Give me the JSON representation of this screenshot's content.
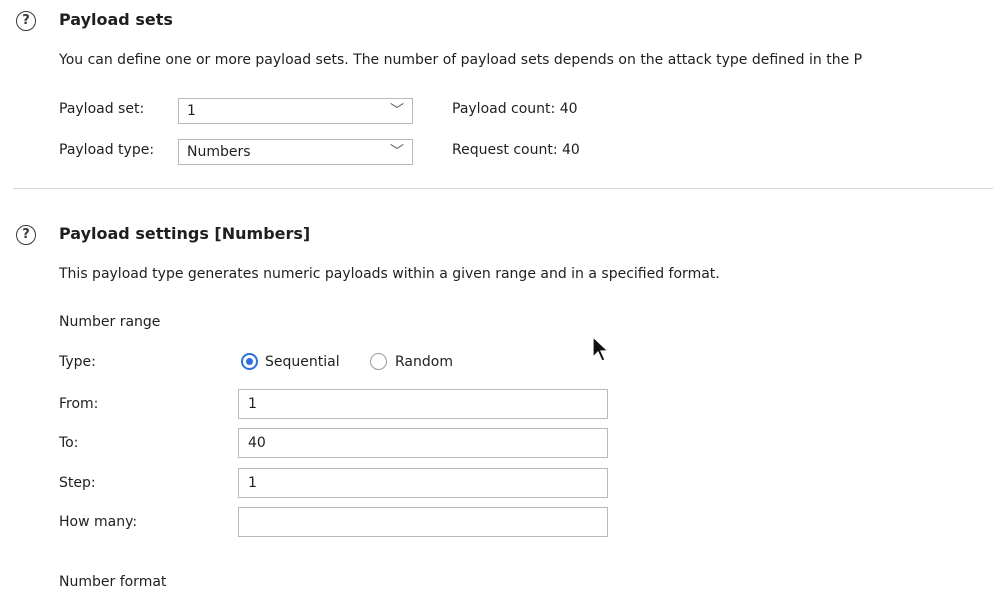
{
  "payload_sets": {
    "title": "Payload sets",
    "description": "You can define one or more payload sets. The number of payload sets depends on the attack type defined in the P",
    "set_label": "Payload set:",
    "set_value": "1",
    "type_label": "Payload type:",
    "type_value": "Numbers",
    "payload_count": "Payload count: 40",
    "request_count": "Request count: 40"
  },
  "payload_settings": {
    "title": "Payload settings [Numbers]",
    "description": "This payload type generates numeric payloads within a given range and in a specified format.",
    "number_range_label": "Number range",
    "type_label": "Type:",
    "sequential_label": "Sequential",
    "random_label": "Random",
    "selected_type": "Sequential",
    "from_label": "From:",
    "from_value": "1",
    "to_label": "To:",
    "to_value": "40",
    "step_label": "Step:",
    "step_value": "1",
    "how_many_label": "How many:",
    "how_many_value": "",
    "number_format_label": "Number format"
  },
  "icons": {
    "help": "?",
    "chevron": "﹀"
  },
  "colors": {
    "accent": "#2f6fd8",
    "border": "#b9b9b9",
    "divider": "#d6d6d6"
  }
}
